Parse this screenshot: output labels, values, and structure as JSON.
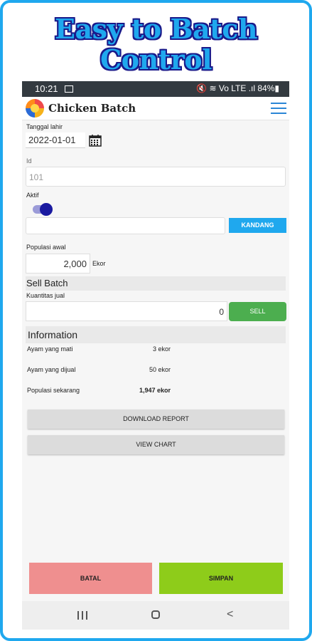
{
  "headline": {
    "line1": "Easy to Batch",
    "line2": "Control"
  },
  "status_bar": {
    "time": "10:21",
    "right": "🔇 ≋ Vo LTE .ıl 84%▮"
  },
  "app_bar": {
    "title": "Chicken Batch",
    "menu_icon": "hamburger-menu-icon"
  },
  "form": {
    "tanggal_lahir": {
      "label": "Tanggal lahir",
      "value": "2022-01-01",
      "icon": "calendar-icon"
    },
    "id": {
      "label": "Id",
      "value": "101"
    },
    "aktif": {
      "label": "Aktif",
      "state": "on",
      "accent": "#1a1aa0"
    },
    "kandang": {
      "value": "",
      "button_label": "KANDANG"
    },
    "populasi_awal": {
      "label": "Populasi awal",
      "value": "2,000",
      "unit": "Ekor"
    }
  },
  "sell_batch": {
    "title": "Sell Batch",
    "kuantitas_label": "Kuantitas jual",
    "kuantitas_value": "0",
    "button_label": "SELL"
  },
  "information": {
    "title": "Information",
    "rows": [
      {
        "label": "Ayam yang mati",
        "value": "3 ekor"
      },
      {
        "label": "Ayam yang dijual",
        "value": "50 ekor"
      },
      {
        "label": "Populasi sekarang",
        "value": "1,947 ekor"
      }
    ]
  },
  "actions": {
    "download_report": "DOWNLOAD REPORT",
    "view_chart": "VIEW CHART"
  },
  "footer": {
    "cancel": "BATAL",
    "save": "SIMPAN"
  },
  "colors": {
    "frame": "#1fa8ee",
    "accent_blue": "#1fa8ee",
    "sell_green": "#4cae4f",
    "cancel_red": "#ef8f8f",
    "save_green": "#8ecc1a"
  }
}
